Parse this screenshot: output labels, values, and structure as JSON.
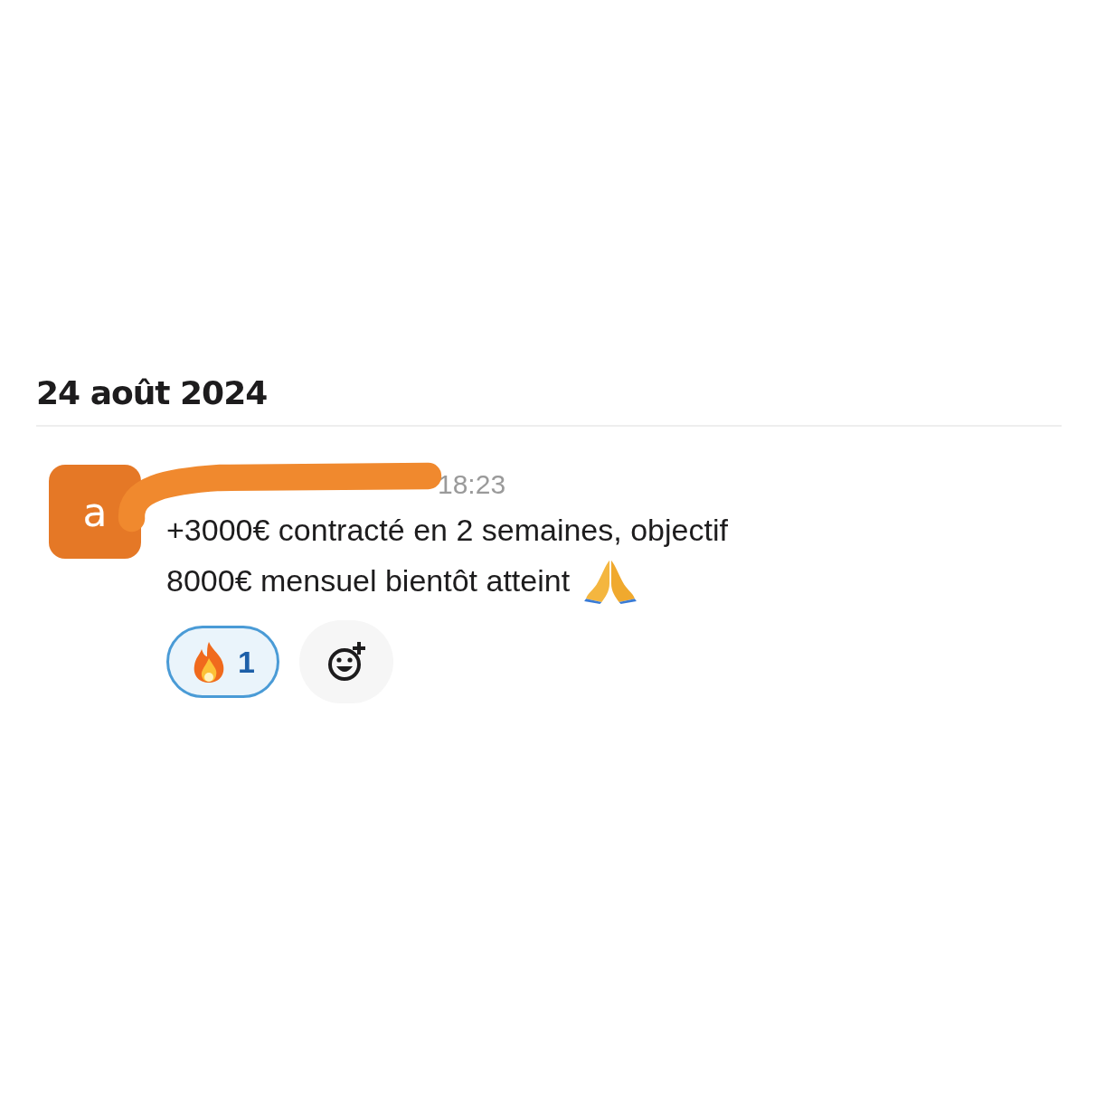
{
  "date_divider": "24 août 2024",
  "message": {
    "avatar_letter": "a",
    "author_redacted": true,
    "time": "18:23",
    "lines": [
      "+3000€ contracté en 2 semaines, objectif",
      "8000€ mensuel bientôt atteint"
    ],
    "reactions": [
      {
        "count": "1",
        "selected": true
      }
    ]
  }
}
